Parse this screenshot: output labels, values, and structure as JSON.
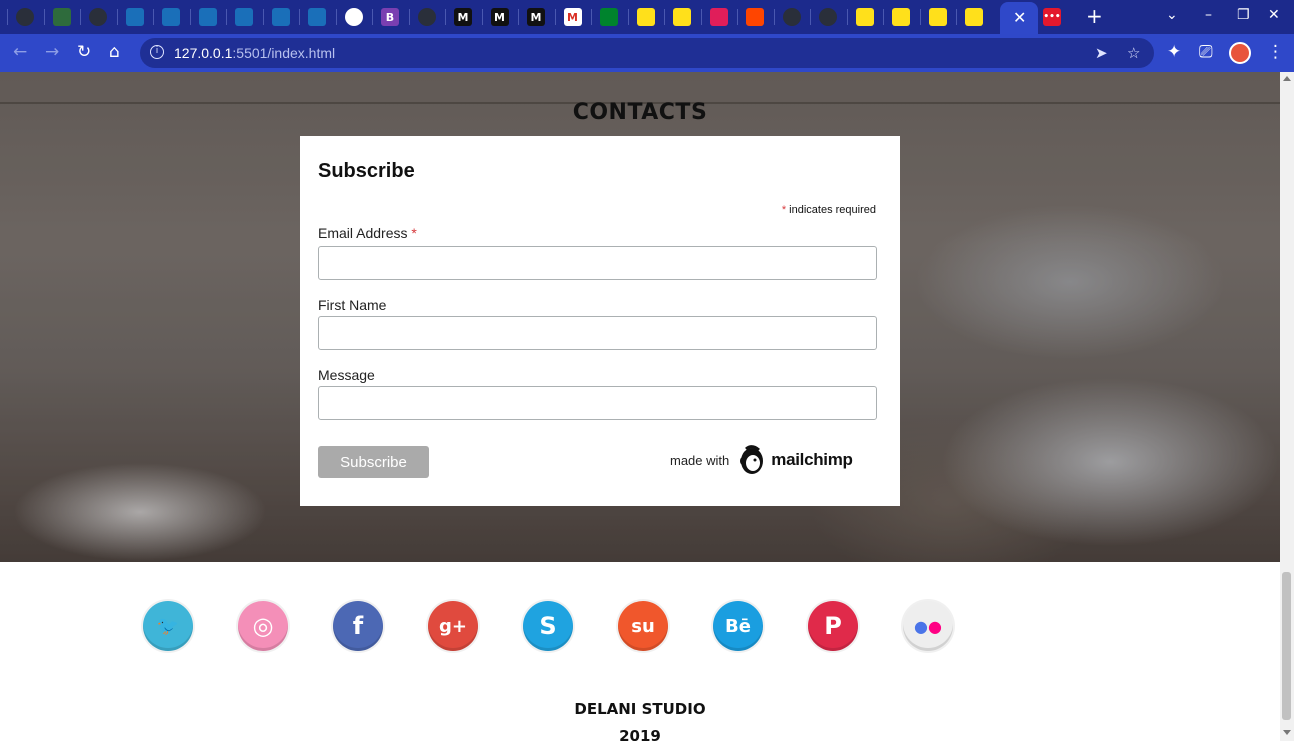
{
  "browser": {
    "tabs_favicons": [
      {
        "icon": "github-icon",
        "color": "#2a2f3a"
      },
      {
        "icon": "tree-icon",
        "color": "#2e6b3c"
      },
      {
        "icon": "github-icon",
        "color": "#2a2f3a"
      },
      {
        "icon": "jquery-icon",
        "color": "#1a6fb9"
      },
      {
        "icon": "jquery-icon",
        "color": "#1a6fb9"
      },
      {
        "icon": "jquery-icon",
        "color": "#1a6fb9"
      },
      {
        "icon": "jquery-icon",
        "color": "#1a6fb9"
      },
      {
        "icon": "jquery-icon",
        "color": "#1a6fb9"
      },
      {
        "icon": "jquery-icon",
        "color": "#1a6fb9"
      },
      {
        "icon": "globe-icon",
        "color": "#ffffff"
      },
      {
        "icon": "bootstrap-icon",
        "color": "#7a3fb1",
        "glyph": "B"
      },
      {
        "icon": "github-icon",
        "color": "#2a2f3a"
      },
      {
        "icon": "medium-icon",
        "color": "#111111",
        "glyph": "M"
      },
      {
        "icon": "medium-icon",
        "color": "#111111",
        "glyph": "M"
      },
      {
        "icon": "medium-icon",
        "color": "#111111",
        "glyph": "M"
      },
      {
        "icon": "gmail-icon",
        "color": "#d93025",
        "glyph": "M"
      },
      {
        "icon": "meet-icon",
        "color": "#00832d"
      },
      {
        "icon": "mailchimp-icon",
        "color": "#ffe01b"
      },
      {
        "icon": "mailchimp-icon",
        "color": "#ffe01b"
      },
      {
        "icon": "slack-icon",
        "color": "#e01e5a"
      },
      {
        "icon": "reddit-icon",
        "color": "#ff4500"
      },
      {
        "icon": "github-icon",
        "color": "#2a2f3a"
      },
      {
        "icon": "github-icon",
        "color": "#2a2f3a"
      },
      {
        "icon": "mailchimp-icon",
        "color": "#ffe01b"
      },
      {
        "icon": "mailchimp-icon",
        "color": "#ffe01b"
      },
      {
        "icon": "mailchimp-icon",
        "color": "#ffe01b"
      },
      {
        "icon": "mailchimp-icon",
        "color": "#ffe01b"
      }
    ],
    "active_tab_close": "✕",
    "extra_tab": {
      "icon": "ellipsis-app-icon",
      "color": "#e3182d"
    },
    "new_tab": "+",
    "url_host": "127.0.0.1",
    "url_path": ":5501/index.html"
  },
  "page": {
    "section_title": "CONTACTS",
    "form": {
      "heading": "Subscribe",
      "required_mark": "*",
      "required_note": "indicates required",
      "email_label": "Email Address",
      "first_name_label": "First Name",
      "message_label": "Message",
      "submit_label": "Subscribe",
      "badge_made_with": "made with",
      "badge_brand": "mailchimp"
    },
    "social_links": [
      {
        "icon": "twitter-icon",
        "color": "#3fb5d8",
        "glyph": "🐦"
      },
      {
        "icon": "dribbble-icon",
        "color": "#f48fb8",
        "glyph": "◎"
      },
      {
        "icon": "facebook-icon",
        "color": "#4c68b4",
        "glyph": "f"
      },
      {
        "icon": "google-plus-icon",
        "color": "#e04a3e",
        "glyph": "g+"
      },
      {
        "icon": "skype-icon",
        "color": "#1fa3e0",
        "glyph": "S"
      },
      {
        "icon": "stumbleupon-icon",
        "color": "#f0572c",
        "glyph": "su"
      },
      {
        "icon": "behance-icon",
        "color": "#1a9ee0",
        "glyph": "Bē"
      },
      {
        "icon": "pinterest-icon",
        "color": "#e02a4a",
        "glyph": "P"
      },
      {
        "icon": "flickr-icon",
        "color": "#eeeeee",
        "glyph": "●●"
      }
    ],
    "footer_name": "DELANI STUDIO",
    "footer_year": "2019"
  }
}
